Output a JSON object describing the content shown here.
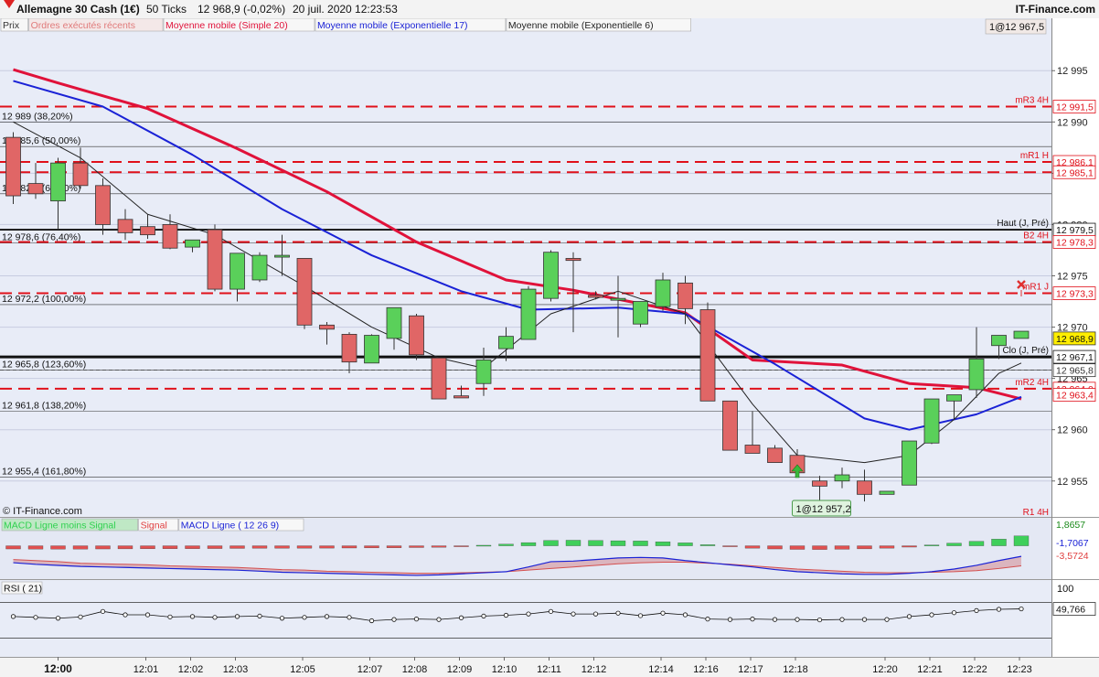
{
  "header": {
    "instrument": "Allemagne 30 Cash (1€)",
    "ticks": "50 Ticks",
    "quote": "12 968,9 (-0,02%)",
    "datetime": "20 juil. 2020 12:23:53",
    "brand": "IT-Finance.com"
  },
  "legend": {
    "items": [
      {
        "label": "Prix",
        "color": "#333333"
      },
      {
        "label": "Ordres exécutés récents",
        "color": "#e07a7a"
      },
      {
        "label": "Moyenne mobile (Simple 20)",
        "color": "#e0123a"
      },
      {
        "label": "Moyenne mobile (Exponentielle 17)",
        "color": "#1a22d6"
      },
      {
        "label": "Moyenne mobile (Exponentielle 6)",
        "color": "#222222"
      }
    ],
    "corner_label": "1@12 967,5"
  },
  "watermark": "© IT-Finance.com",
  "chart_data": [
    {
      "type": "candlestick",
      "title": "Allemagne 30 Cash (1€)",
      "yticks": [
        12995,
        12990,
        12985,
        12980,
        12975,
        12970,
        12965,
        12960,
        12955
      ],
      "ytick_labels": [
        "12 995",
        "12 990",
        "12 985",
        "12 980",
        "12 975",
        "12 970",
        "12 965",
        "12 960",
        "12 955"
      ],
      "ylim": [
        12951.5,
        12998.5
      ],
      "x_labels": [
        "12:00",
        "12:01",
        "12:02",
        "12:03",
        "12:05",
        "12:07",
        "12:08",
        "12:09",
        "12:10",
        "12:11",
        "12:12",
        "12:14",
        "12:16",
        "12:17",
        "12:18",
        "12:20",
        "12:21",
        "12:22",
        "12:23"
      ],
      "x_label_bar_index": [
        2,
        6,
        8,
        10,
        13,
        16,
        18,
        20,
        22,
        24,
        26,
        29,
        31,
        33,
        35,
        39,
        41,
        43,
        45
      ],
      "candles": [
        [
          12988.5,
          12989.0,
          12982.0,
          12982.8
        ],
        [
          12984.0,
          12986.0,
          12982.5,
          12983.0
        ],
        [
          12982.3,
          12986.5,
          12979.5,
          12986.0
        ],
        [
          12986.0,
          12987.5,
          12983.5,
          12983.8
        ],
        [
          12983.8,
          12984.5,
          12979.0,
          12980.0
        ],
        [
          12980.5,
          12981.5,
          12978.5,
          12979.2
        ],
        [
          12979.8,
          12981.0,
          12978.6,
          12979.0
        ],
        [
          12980.0,
          12981.0,
          12977.6,
          12977.7
        ],
        [
          12977.8,
          12978.4,
          12977.3,
          12978.5
        ],
        [
          12979.5,
          12980.0,
          12973.5,
          12973.7
        ],
        [
          12973.7,
          12975.3,
          12972.5,
          12977.2
        ],
        [
          12974.6,
          12977.3,
          12974.4,
          12977.0
        ],
        [
          12977.0,
          12979.0,
          12975.0,
          12977.0
        ],
        [
          12976.7,
          12976.5,
          12969.8,
          12970.2
        ],
        [
          12970.2,
          12970.5,
          12968.3,
          12969.8
        ],
        [
          12969.3,
          12969.5,
          12965.5,
          12966.6
        ],
        [
          12966.5,
          12969.3,
          12966.6,
          12969.2
        ],
        [
          12968.9,
          12971.0,
          12967.8,
          12971.9
        ],
        [
          12971.1,
          12971.3,
          12966.8,
          12967.3
        ],
        [
          12967.0,
          12966.5,
          12963.5,
          12963.0
        ],
        [
          12963.3,
          12964.3,
          12963.3,
          12963.1
        ],
        [
          12964.5,
          12968.0,
          12963.3,
          12966.8
        ],
        [
          12967.9,
          12970.0,
          12966.7,
          12969.1
        ],
        [
          12968.8,
          12974.0,
          12968.8,
          12973.7
        ],
        [
          12972.8,
          12977.5,
          12972.5,
          12977.3
        ],
        [
          12976.7,
          12977.3,
          12969.5,
          12976.5
        ],
        [
          12973.1,
          12973.5,
          12972.7,
          12972.9
        ],
        [
          12972.8,
          12975.0,
          12969.0,
          12972.8
        ],
        [
          12970.3,
          12972.5,
          12970.0,
          12972.5
        ],
        [
          12972.0,
          12975.3,
          12971.6,
          12974.6
        ],
        [
          12974.3,
          12975.0,
          12970.3,
          12971.8
        ],
        [
          12971.7,
          12972.4,
          12963.4,
          12962.8
        ],
        [
          12962.8,
          12962.5,
          12958.5,
          12958.0
        ],
        [
          12958.5,
          12961.8,
          12957.8,
          12957.7
        ],
        [
          12958.2,
          12958.5,
          12957.0,
          12956.8
        ],
        [
          12957.5,
          12958.1,
          12955.5,
          12955.8
        ],
        [
          12955.0,
          12955.5,
          12952.3,
          12954.5
        ],
        [
          12955.0,
          12956.3,
          12954.3,
          12955.6
        ],
        [
          12955.0,
          12956.1,
          12953.0,
          12953.7
        ],
        [
          12953.7,
          12954.0,
          12953.8,
          12954.0
        ],
        [
          12954.6,
          12958.2,
          12954.9,
          12958.9
        ],
        [
          12958.7,
          12961.2,
          12958.6,
          12963.0
        ],
        [
          12962.8,
          12963.4,
          12961.0,
          12963.4
        ],
        [
          12963.9,
          12970.0,
          12963.1,
          12966.9
        ],
        [
          12968.2,
          12969.0,
          12966.9,
          12969.2
        ],
        [
          12968.9,
          12969.2,
          12968.9,
          12969.6
        ]
      ],
      "series": [
        {
          "name": "Moyenne mobile (Simple 20)",
          "color": "#e0123a",
          "values": [
            [
              0,
              12995.1
            ],
            [
              2,
              12993.8
            ],
            [
              6,
              12991.3
            ],
            [
              10,
              12987.4
            ],
            [
              14,
              12983.2
            ],
            [
              18,
              12978.3
            ],
            [
              22,
              12974.6
            ],
            [
              25,
              12973.6
            ],
            [
              30,
              12971.4
            ],
            [
              33,
              12966.8
            ],
            [
              37,
              12966.3
            ],
            [
              40,
              12964.5
            ],
            [
              43,
              12964.1
            ],
            [
              45,
              12963.0
            ]
          ]
        },
        {
          "name": "Moyenne mobile (Exponentielle 17)",
          "color": "#1a22d6",
          "values": [
            [
              0,
              12994.0
            ],
            [
              4,
              12991.5
            ],
            [
              8,
              12986.8
            ],
            [
              12,
              12981.5
            ],
            [
              16,
              12977.0
            ],
            [
              20,
              12973.5
            ],
            [
              23,
              12971.7
            ],
            [
              27,
              12971.9
            ],
            [
              30,
              12971.3
            ],
            [
              34,
              12966.4
            ],
            [
              38,
              12961.1
            ],
            [
              40,
              12960.0
            ],
            [
              43,
              12961.5
            ],
            [
              45,
              12963.2
            ]
          ]
        },
        {
          "name": "Moyenne mobile (Exponentielle 6)",
          "color": "#222222",
          "values": [
            [
              0,
              12990.0
            ],
            [
              3,
              12986.5
            ],
            [
              6,
              12981.0
            ],
            [
              9,
              12979.0
            ],
            [
              13,
              12974.0
            ],
            [
              16,
              12970.0
            ],
            [
              19,
              12967.0
            ],
            [
              21,
              12966.0
            ],
            [
              24,
              12971.3
            ],
            [
              27,
              12973.5
            ],
            [
              30,
              12971.3
            ],
            [
              33,
              12962.5
            ],
            [
              35,
              12957.5
            ],
            [
              38,
              12956.8
            ],
            [
              40,
              12957.5
            ],
            [
              42,
              12961.0
            ],
            [
              44,
              12965.5
            ],
            [
              45,
              12966.5
            ]
          ]
        }
      ],
      "hlines": [
        {
          "label": "12 989 (38,20%)",
          "value": 12990.0,
          "style": "thin",
          "color": "#333333"
        },
        {
          "label": "12 985,6 (50,00%)",
          "value": 12987.6,
          "style": "thin",
          "color": "#333333"
        },
        {
          "label": "12 982,6 (61,80%)",
          "value": 12983.0,
          "style": "thin",
          "color": "#333333"
        },
        {
          "label": "12 978,6 (76,40%)",
          "value": 12978.2,
          "style": "thin",
          "color": "#333333"
        },
        {
          "label": "12 972,2 (100,00%)",
          "value": 12972.2,
          "style": "thin",
          "color": "#333333"
        },
        {
          "label": "12 965,8 (123,60%)",
          "value": 12965.8,
          "style": "thin",
          "color": "#333333"
        },
        {
          "label": "12 961,8 (138,20%)",
          "value": 12961.8,
          "style": "thin",
          "color": "#333333"
        },
        {
          "label": "12 955,4 (161,80%)",
          "value": 12955.4,
          "style": "thin",
          "color": "#333333"
        }
      ],
      "levels": [
        {
          "label": "mR3 4H",
          "value": 12991.5,
          "price_label": "12 991,5",
          "style": "dash",
          "color": "#e0101a"
        },
        {
          "label": "mR1 H",
          "value": 12986.1,
          "price_label": "12 986,1",
          "style": "dash",
          "color": "#e0101a"
        },
        {
          "label": "",
          "value": 12985.1,
          "price_label": "12 985,1",
          "style": "dash",
          "color": "#e0101a"
        },
        {
          "label": "Haut (J, Pré)",
          "value": 12979.5,
          "price_label": "12 979,5",
          "style": "solid",
          "color": "#111111"
        },
        {
          "label": "B2 4H",
          "value": 12978.3,
          "price_label": "12 978,3",
          "style": "dash",
          "color": "#e0101a"
        },
        {
          "label": "mR1 J",
          "value": 12973.3,
          "price_label": "12 973,3",
          "style": "dash",
          "color": "#e0101a"
        },
        {
          "label": "Clo (J, Pré)",
          "value": 12967.1,
          "price_label": "12 967,1",
          "style": "thick",
          "color": "#111111"
        },
        {
          "label": "",
          "value": 12965.8,
          "price_label": "12 965,8",
          "style": "dash",
          "color": "#333333"
        },
        {
          "label": "mR2 4H",
          "value": 12964.0,
          "price_label": "12 964,0",
          "style": "dash",
          "color": "#e0101a"
        },
        {
          "label": "",
          "value": 12963.4,
          "price_label": "12 963,4",
          "style": "none",
          "color": "#e0101a"
        }
      ],
      "current_price": {
        "value": 12968.9,
        "label": "12 968,9",
        "color": "#ffee00"
      },
      "extra_labels": [
        {
          "text": "R1 4H",
          "color": "#e0101a"
        }
      ],
      "low_marker": {
        "label": "1@12 957,2",
        "bar_index": 36
      },
      "buy_arrow_bar_index": 35,
      "sell_marker_bar_index": 45,
      "gridlines": true
    },
    {
      "type": "bar",
      "title": "MACD Ligne moins Signal",
      "legend": [
        {
          "label": "MACD Ligne moins Signal",
          "color": "#2ed14e"
        },
        {
          "label": "Signal",
          "color": "#e04040"
        },
        {
          "label": "MACD Ligne ( 12 26 9)",
          "color": "#1a22d6"
        }
      ],
      "histogram": [
        -0.6,
        -0.62,
        -0.63,
        -0.62,
        -0.6,
        -0.58,
        -0.57,
        -0.56,
        -0.55,
        -0.52,
        -0.5,
        -0.48,
        -0.47,
        -0.45,
        -0.44,
        -0.42,
        -0.4,
        -0.38,
        -0.33,
        -0.28,
        -0.15,
        0.1,
        0.3,
        0.6,
        1.0,
        1.05,
        1.0,
        0.95,
        0.9,
        0.75,
        0.55,
        0.2,
        -0.15,
        -0.45,
        -0.6,
        -0.68,
        -0.7,
        -0.66,
        -0.58,
        -0.45,
        -0.25,
        0.15,
        0.5,
        0.85,
        1.25,
        1.86
      ],
      "macd_line": [
        -3.2,
        -3.5,
        -3.7,
        -3.9,
        -4.0,
        -4.1,
        -4.2,
        -4.3,
        -4.4,
        -4.5,
        -4.6,
        -4.8,
        -5.0,
        -5.1,
        -5.2,
        -5.3,
        -5.4,
        -5.5,
        -5.6,
        -5.5,
        -5.3,
        -5.1,
        -4.9,
        -4.0,
        -3.0,
        -2.9,
        -2.6,
        -2.3,
        -2.2,
        -2.3,
        -2.8,
        -3.2,
        -3.6,
        -4.0,
        -4.5,
        -4.9,
        -5.1,
        -5.3,
        -5.4,
        -5.4,
        -5.2,
        -4.9,
        -4.4,
        -3.7,
        -2.8,
        -2.0
      ],
      "signal_line": [
        -2.6,
        -2.8,
        -3.0,
        -3.3,
        -3.4,
        -3.5,
        -3.6,
        -3.8,
        -3.9,
        -4.0,
        -4.1,
        -4.3,
        -4.5,
        -4.6,
        -4.8,
        -4.9,
        -5.0,
        -5.1,
        -5.2,
        -5.2,
        -5.1,
        -5.0,
        -4.9,
        -4.6,
        -4.3,
        -4.0,
        -3.7,
        -3.4,
        -3.2,
        -3.1,
        -3.1,
        -3.3,
        -3.5,
        -3.8,
        -4.1,
        -4.4,
        -4.6,
        -4.8,
        -5.0,
        -5.1,
        -5.1,
        -5.0,
        -4.9,
        -4.7,
        -4.3,
        -3.8
      ],
      "ylim": [
        -6.3,
        2.0
      ],
      "value_labels": [
        "1,8657",
        "-1,7067",
        "-3,5724"
      ]
    },
    {
      "type": "line",
      "title": "RSI ( 21)",
      "yticks": [
        100
      ],
      "ytick_labels": [
        "100"
      ],
      "values": [
        49.0,
        48.8,
        48.6,
        48.9,
        50.2,
        49.4,
        49.4,
        48.9,
        49.0,
        48.8,
        49.0,
        49.1,
        48.6,
        48.8,
        49.0,
        48.8,
        48.0,
        48.3,
        48.4,
        48.3,
        48.7,
        49.1,
        49.3,
        49.6,
        50.2,
        49.6,
        49.6,
        49.8,
        49.2,
        49.8,
        49.4,
        48.4,
        48.3,
        48.4,
        48.3,
        48.3,
        48.2,
        48.3,
        48.3,
        48.3,
        49.0,
        49.4,
        49.9,
        50.4,
        50.7,
        50.8
      ],
      "ylim": [
        44,
        52
      ],
      "last_label": "49,766"
    }
  ]
}
